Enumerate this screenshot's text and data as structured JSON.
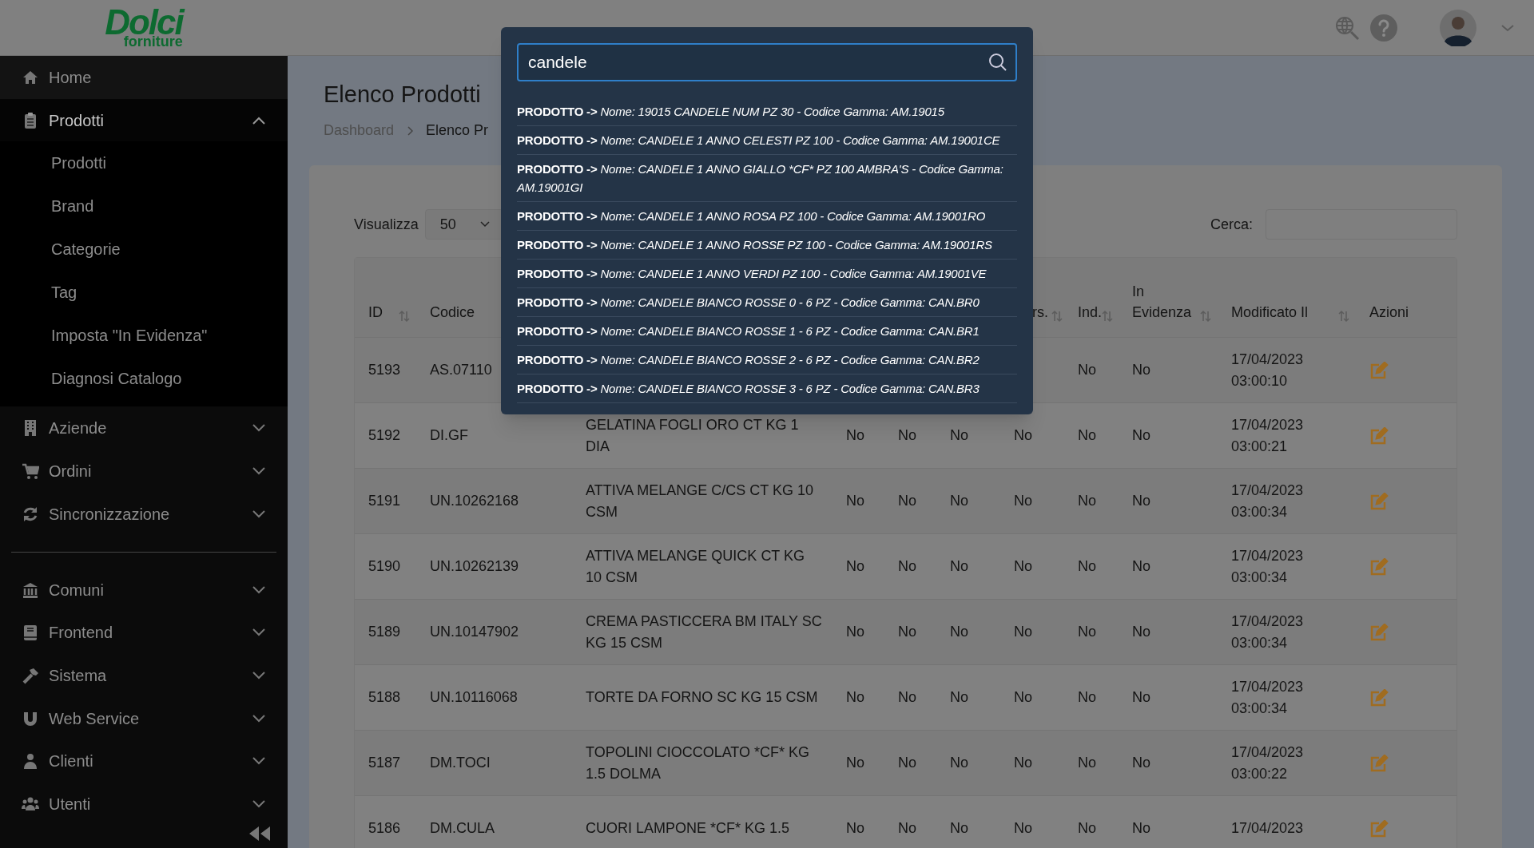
{
  "header": {
    "logo": {
      "word": "Dolci",
      "tagline": "forniture"
    }
  },
  "sidebar": {
    "sections": [
      [
        {
          "label": "Home"
        },
        {
          "label": "Prodotti",
          "expanded": true,
          "children": [
            {
              "label": "Prodotti"
            },
            {
              "label": "Brand"
            },
            {
              "label": "Categorie"
            },
            {
              "label": "Tag"
            },
            {
              "label": "Imposta \"In Evidenza\""
            },
            {
              "label": "Diagnosi Catalogo"
            }
          ]
        },
        {
          "label": "Aziende",
          "expanded": false
        },
        {
          "label": "Ordini",
          "expanded": false
        },
        {
          "label": "Sincronizzazione",
          "expanded": false
        }
      ],
      [
        {
          "label": "Comuni",
          "expanded": false
        },
        {
          "label": "Frontend",
          "expanded": false
        },
        {
          "label": "Sistema",
          "expanded": false
        },
        {
          "label": "Web Service",
          "expanded": false
        },
        {
          "label": "Clienti",
          "expanded": false
        },
        {
          "label": "Utenti",
          "expanded": false
        }
      ]
    ]
  },
  "page": {
    "title": "Elenco Prodotti",
    "breadcrumb": [
      "Dashboard",
      "Elenco Pr"
    ]
  },
  "length_select": {
    "label": "Visualizza",
    "value": "50"
  },
  "search": {
    "label": "Cerca:"
  },
  "table": {
    "columns": [
      {
        "label": "ID",
        "sortable": true
      },
      {
        "label": "Codice"
      },
      {
        "label": "rs.",
        "sortable": true
      },
      {
        "label": "Ind.",
        "sortable": true
      },
      {
        "label": "In Evidenza",
        "sortable": true
      },
      {
        "label": "Modificato Il",
        "sortable": true
      },
      {
        "label": "Azioni",
        "sortable": false
      }
    ],
    "rows": [
      {
        "id": "5193",
        "code": "AS.07110",
        "flags": [
          "No",
          "No"
        ],
        "modified": "17/04/2023 03:00:10"
      },
      {
        "id": "5192",
        "code": "DI.GF",
        "name": "GELATINA FOGLI ORO CT KG 1 DIA",
        "flags": [
          "No",
          "No",
          "No",
          "No",
          "No",
          "No"
        ],
        "modified": "17/04/2023 03:00:21"
      },
      {
        "id": "5191",
        "code": "UN.10262168",
        "name": "ATTIVA MELANGE C/CS CT KG 10 CSM",
        "flags": [
          "No",
          "No",
          "No",
          "No",
          "No",
          "No"
        ],
        "modified": "17/04/2023 03:00:34"
      },
      {
        "id": "5190",
        "code": "UN.10262139",
        "name": "ATTIVA MELANGE QUICK CT KG 10 CSM",
        "flags": [
          "No",
          "No",
          "No",
          "No",
          "No",
          "No"
        ],
        "modified": "17/04/2023 03:00:34"
      },
      {
        "id": "5189",
        "code": "UN.10147902",
        "name": "CREMA PASTICCERA BM ITALY SC KG 15 CSM",
        "flags": [
          "No",
          "No",
          "No",
          "No",
          "No",
          "No"
        ],
        "modified": "17/04/2023 03:00:34"
      },
      {
        "id": "5188",
        "code": "UN.10116068",
        "name": "TORTE DA FORNO SC KG 15 CSM",
        "flags": [
          "No",
          "No",
          "No",
          "No",
          "No",
          "No"
        ],
        "modified": "17/04/2023 03:00:34"
      },
      {
        "id": "5187",
        "code": "DM.TOCI",
        "name": "TOPOLINI CIOCCOLATO *CF* KG 1.5 DOLMA",
        "flags": [
          "No",
          "No",
          "No",
          "No",
          "No",
          "No"
        ],
        "modified": "17/04/2023 03:00:22"
      },
      {
        "id": "5186",
        "code": "DM.CULA",
        "name": "CUORI LAMPONE *CF* KG 1.5",
        "flags": [
          "No",
          "No",
          "No",
          "No",
          "No",
          "No"
        ],
        "modified": "17/04/2023"
      }
    ]
  },
  "search_modal": {
    "query": "candele",
    "results": [
      {
        "type": "PRODOTTO ->",
        "text": "Nome: 19015 CANDELE NUM PZ 30 - Codice Gamma: AM.19015"
      },
      {
        "type": "PRODOTTO ->",
        "text": "Nome: CANDELE 1 ANNO CELESTI PZ 100 - Codice Gamma: AM.19001CE"
      },
      {
        "type": "PRODOTTO ->",
        "text": "Nome: CANDELE 1 ANNO GIALLO *CF* PZ 100 AMBRA'S - Codice Gamma: AM.19001GI"
      },
      {
        "type": "PRODOTTO ->",
        "text": "Nome: CANDELE 1 ANNO ROSA PZ 100 - Codice Gamma: AM.19001RO"
      },
      {
        "type": "PRODOTTO ->",
        "text": "Nome: CANDELE 1 ANNO ROSSE PZ 100 - Codice Gamma: AM.19001RS"
      },
      {
        "type": "PRODOTTO ->",
        "text": "Nome: CANDELE 1 ANNO VERDI PZ 100 - Codice Gamma: AM.19001VE"
      },
      {
        "type": "PRODOTTO ->",
        "text": "Nome: CANDELE BIANCO ROSSE 0 - 6 PZ - Codice Gamma: CAN.BR0"
      },
      {
        "type": "PRODOTTO ->",
        "text": "Nome: CANDELE BIANCO ROSSE 1 - 6 PZ - Codice Gamma: CAN.BR1"
      },
      {
        "type": "PRODOTTO ->",
        "text": "Nome: CANDELE BIANCO ROSSE 2 - 6 PZ - Codice Gamma: CAN.BR2"
      },
      {
        "type": "PRODOTTO ->",
        "text": "Nome: CANDELE BIANCO ROSSE 3 - 6 PZ - Codice Gamma: CAN.BR3"
      }
    ]
  }
}
